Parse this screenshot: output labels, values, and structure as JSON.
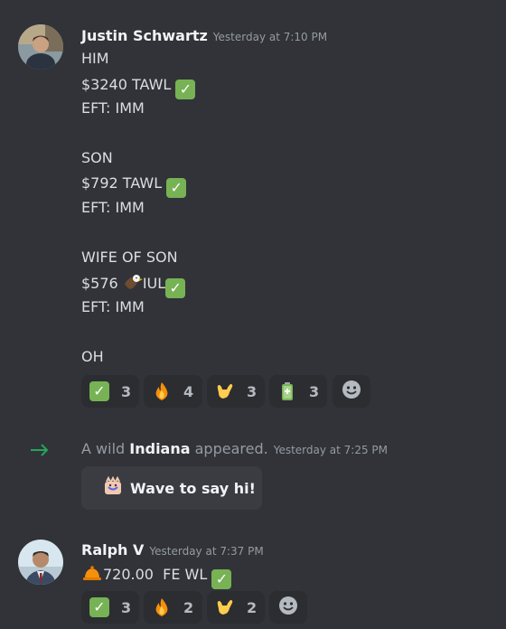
{
  "messages": [
    {
      "author": "Justin Schwartz",
      "timestamp": "Yesterday at 7:10 PM",
      "lines": [
        "HIM",
        "$3240 TAWL",
        "EFT: IMM",
        "SON",
        "$792 TAWL",
        "EFT: IMM",
        "WIFE OF SON",
        "$576",
        "IUL",
        "EFT: IMM",
        "OH"
      ],
      "reactions": [
        {
          "emoji": "check-mark-icon",
          "count": "3"
        },
        {
          "emoji": "fire-icon",
          "count": "4"
        },
        {
          "emoji": "call-me-hand-icon",
          "count": "3"
        },
        {
          "emoji": "battery-icon",
          "count": "3"
        }
      ]
    },
    {
      "author": "Ralph V",
      "timestamp": "Yesterday at 7:37 PM",
      "line": "720.00  FE WL",
      "reactions": [
        {
          "emoji": "check-mark-icon",
          "count": "3"
        },
        {
          "emoji": "fire-icon",
          "count": "2"
        },
        {
          "emoji": "call-me-hand-icon",
          "count": "2"
        }
      ]
    }
  ],
  "join": {
    "prefix": "A wild",
    "name": "Indiana",
    "suffix": "appeared.",
    "timestamp": "Yesterday at 7:25 PM",
    "wave_label": "Wave to say hi!"
  },
  "colors": {
    "background": "#313338",
    "reaction_bg": "#2b2d31",
    "check": "#77b255",
    "join_arrow": "#23a55a"
  }
}
